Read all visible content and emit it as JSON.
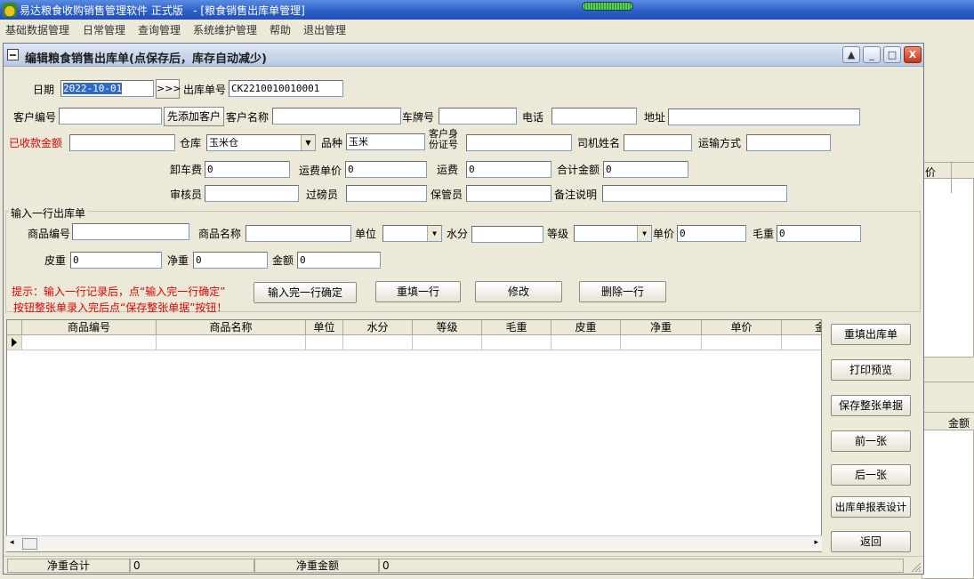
{
  "app": {
    "title": "易达粮食收购销售管理软件 正式版   - [粮食销售出库单管理]",
    "menu": [
      "基础数据管理",
      "日常管理",
      "查询管理",
      "系统维护管理",
      "帮助",
      "退出管理"
    ]
  },
  "background": {
    "col_price": "价",
    "col_amount": "金额"
  },
  "dialog": {
    "title": "编辑粮食销售出库单(点保存后，库存自动减少)",
    "window_buttons": {
      "help": "▲",
      "minimize": "_",
      "maximize": "□",
      "close": "X"
    }
  },
  "header_form": {
    "date_label": "日期",
    "date_value": "2022-10-01",
    "date_picker": ">>>",
    "order_no_label": "出库单号",
    "order_no_value": "CK2210010010001",
    "customer_no_label": "客户编号",
    "add_customer": "先添加客户",
    "customer_name_label": "客户名称",
    "plate_label": "车牌号",
    "phone_label": "电话",
    "address_label": "地址",
    "received_amount_label": "已收款金额",
    "warehouse_label": "仓库",
    "warehouse_value": "玉米仓",
    "variety_label": "品种",
    "variety_value": "玉米",
    "customer_id_label_1": "客户身",
    "customer_id_label_2": "份证号",
    "driver_label": "司机姓名",
    "transport_label": "运输方式",
    "unload_fee_label": "卸车费",
    "unload_fee_value": "0",
    "freight_price_label": "运费单价",
    "freight_price_value": "0",
    "freight_label": "运费",
    "freight_value": "0",
    "total_label": "合计金额",
    "total_value": "0",
    "auditor_label": "审核员",
    "weigher_label": "过磅员",
    "keeper_label": "保管员",
    "remark_label": "备注说明"
  },
  "line_form": {
    "group_title": "输入一行出库单",
    "item_no_label": "商品编号",
    "item_name_label": "商品名称",
    "unit_label": "单位",
    "moisture_label": "水分",
    "grade_label": "等级",
    "price_label": "单价",
    "price_value": "0",
    "gross_label": "毛重",
    "gross_value": "0",
    "tare_label": "皮重",
    "tare_value": "0",
    "net_label": "净重",
    "net_value": "0",
    "amount_label": "金额",
    "amount_value": "0",
    "hint_line1": "提示：输入一行记录后，点“输入完一行确定”",
    "hint_line2": "按钮整张单录入完后点“保存整张单据”按钮！",
    "confirm_row": "输入完一行确定",
    "refill_row": "重填一行",
    "modify": "修改",
    "delete_row": "删除一行"
  },
  "grid": {
    "columns": [
      "商品编号",
      "商品名称",
      "单位",
      "水分",
      "等级",
      "毛重",
      "皮重",
      "净重",
      "单价",
      "金"
    ]
  },
  "side_buttons": [
    "重填出库单",
    "打印预览",
    "保存整张单据",
    "前一张",
    "后一张",
    "出库单报表设计",
    "返回"
  ],
  "status": {
    "net_total_label": "净重合计",
    "net_total_value": "0",
    "net_amount_label": "净重金额",
    "net_amount_value": "0"
  }
}
